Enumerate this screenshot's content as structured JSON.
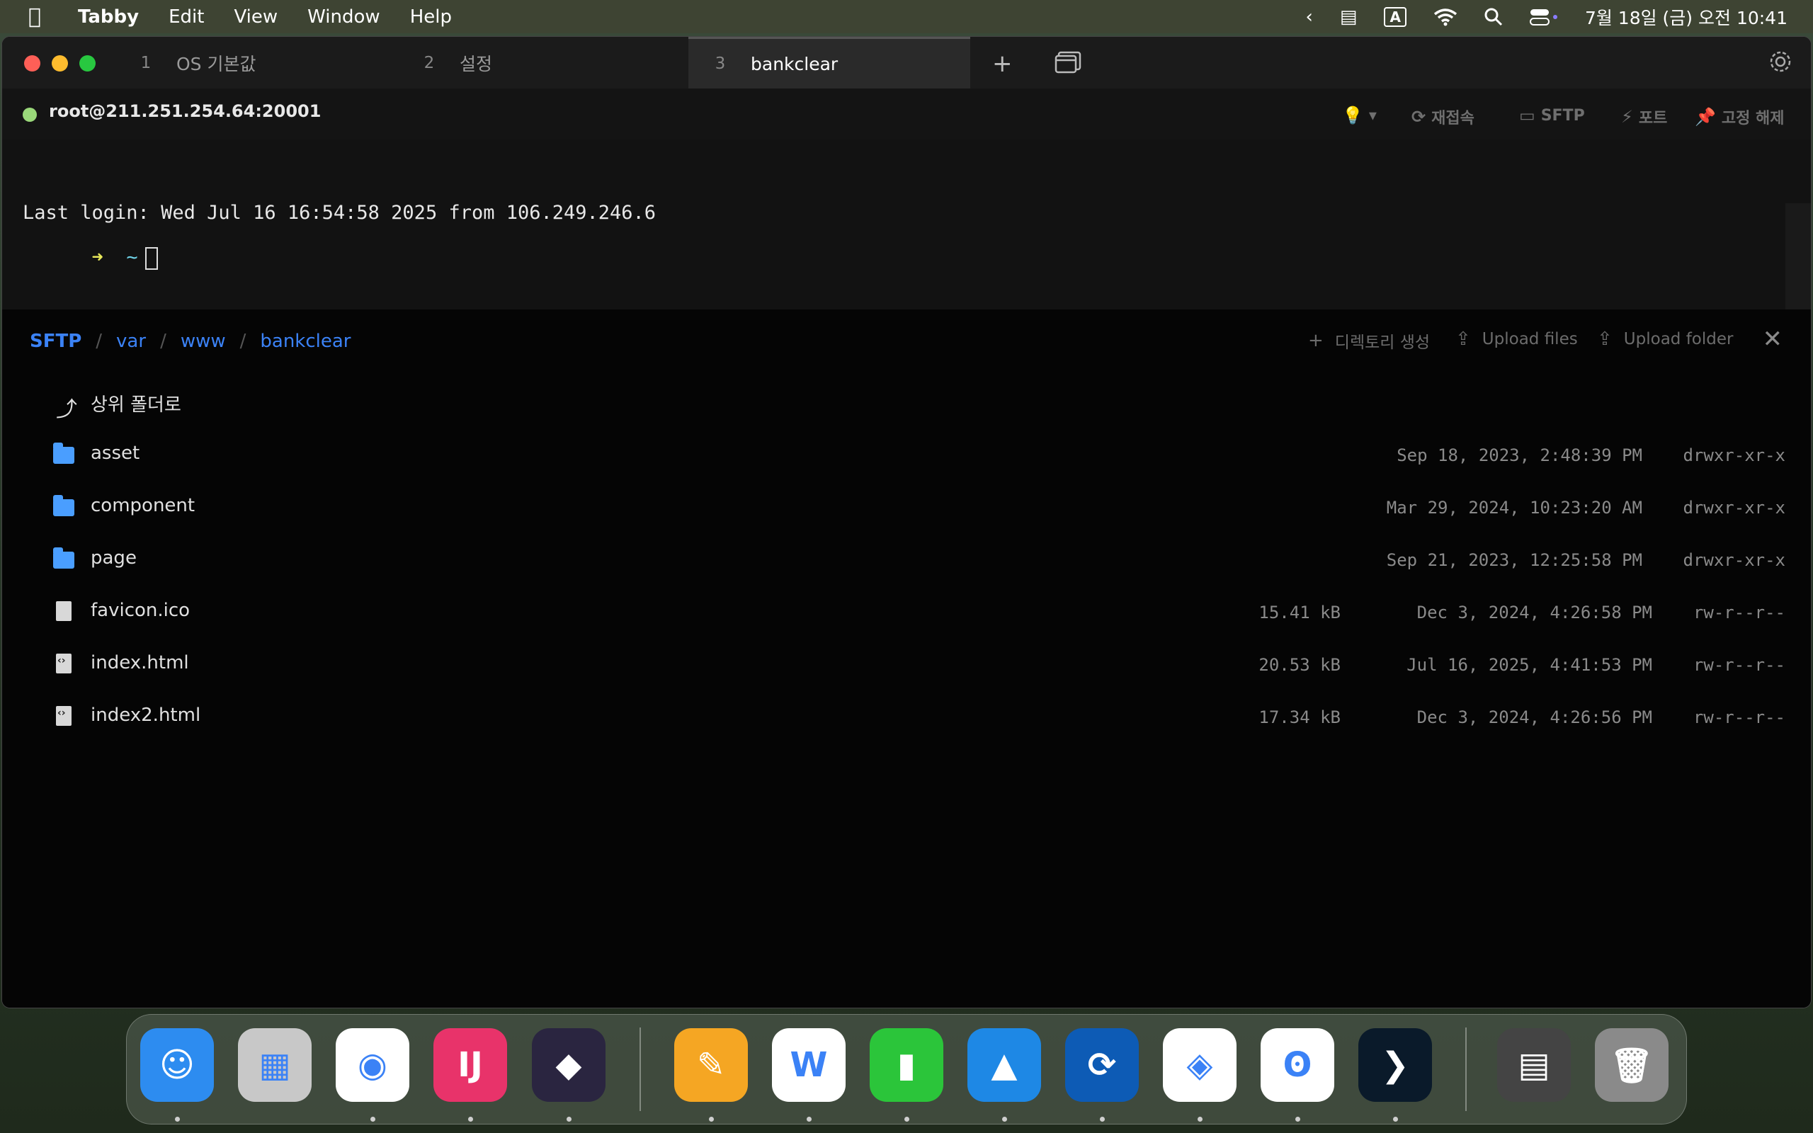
{
  "menubar": {
    "app_name": "Tabby",
    "menus": [
      "Edit",
      "View",
      "Window",
      "Help"
    ],
    "clock": "7월 18일 (금) 오전 10:41",
    "input_indicator": "A"
  },
  "tabs": [
    {
      "num": "1",
      "label": "OS 기본값"
    },
    {
      "num": "2",
      "label": "설정"
    },
    {
      "num": "3",
      "label": "bankclear"
    }
  ],
  "connection": {
    "title": "root@211.251.254.64:20001",
    "status_color": "#9ad87a"
  },
  "toolbar": {
    "reconnect": "재접속",
    "sftp": "SFTP",
    "ports": "포트",
    "unpin": "고정 해제"
  },
  "terminal": {
    "line1": "Last login: Wed Jul 16 16:54:58 2025 from 106.249.246.6",
    "prompt_arrow": "➜",
    "prompt_dir": "~"
  },
  "sftp": {
    "breadcrumb": [
      "SFTP",
      "var",
      "www",
      "bankclear"
    ],
    "create_dir": "디렉토리 생성",
    "upload_files": "Upload files",
    "upload_folder": "Upload folder",
    "parent_label": "상위 폴더로",
    "entries": [
      {
        "name": "asset",
        "type": "folder",
        "size": "",
        "date": "Sep 18, 2023, 2:48:39 PM",
        "perm": "drwxr-xr-x"
      },
      {
        "name": "component",
        "type": "folder",
        "size": "",
        "date": "Mar 29, 2024, 10:23:20 AM",
        "perm": "drwxr-xr-x"
      },
      {
        "name": "page",
        "type": "folder",
        "size": "",
        "date": "Sep 21, 2023, 12:25:58 PM",
        "perm": "drwxr-xr-x"
      },
      {
        "name": "favicon.ico",
        "type": "file",
        "size": "15.41 kB",
        "date": "Dec 3, 2024, 4:26:58 PM",
        "perm": "rw-r--r--"
      },
      {
        "name": "index.html",
        "type": "code",
        "size": "20.53 kB",
        "date": "Jul 16, 2025, 4:41:53 PM",
        "perm": "rw-r--r--"
      },
      {
        "name": "index2.html",
        "type": "code",
        "size": "17.34 kB",
        "date": "Dec 3, 2024, 4:26:56 PM",
        "perm": "rw-r--r--"
      }
    ]
  },
  "dock": {
    "apps": [
      {
        "name": "finder-icon",
        "color": "#2d8cf0",
        "glyph": "☺"
      },
      {
        "name": "launchpad-icon",
        "color": "#c8c8c8",
        "glyph": "▦"
      },
      {
        "name": "chrome-icon",
        "color": "#ffffff",
        "glyph": "◉"
      },
      {
        "name": "intellij-icon",
        "color": "#e8336a",
        "glyph": "IJ"
      },
      {
        "name": "obsidian-icon",
        "color": "#2a2540",
        "glyph": "◆"
      },
      {
        "name": "pages-icon",
        "color": "#f5a623",
        "glyph": "✎"
      },
      {
        "name": "naver-whale-icon",
        "color": "#ffffff",
        "glyph": "W"
      },
      {
        "name": "numbers-icon",
        "color": "#2bc53a",
        "glyph": "▮"
      },
      {
        "name": "keynote-icon",
        "color": "#1e88e5",
        "glyph": "▲"
      },
      {
        "name": "time-machine-icon",
        "color": "#0d5bb5",
        "glyph": "⟳"
      },
      {
        "name": "naver-works-icon",
        "color": "#ffffff",
        "glyph": "◈"
      },
      {
        "name": "dbeaver-icon",
        "color": "#ffffff",
        "glyph": "ʘ"
      },
      {
        "name": "terminal-app-icon",
        "color": "#0a1a2a",
        "glyph": "❯"
      },
      {
        "name": "preview-window-icon",
        "color": "#444444",
        "glyph": "▤"
      },
      {
        "name": "trash-icon",
        "color": "#8a8a8a",
        "glyph": "🗑"
      }
    ]
  }
}
